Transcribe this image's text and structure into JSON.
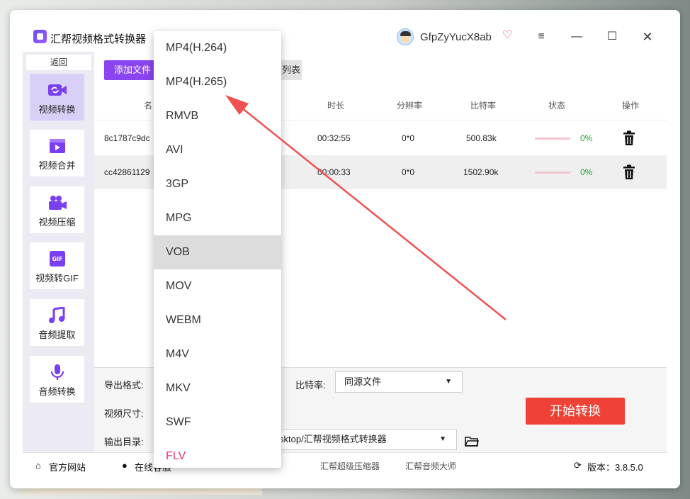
{
  "app": {
    "title": "汇帮视频格式转换器",
    "username": "GfpZyYucX8ab"
  },
  "window_controls": {
    "menu": "≡",
    "minimize": "—",
    "maximize": "☐",
    "close": "✕"
  },
  "sidebar": {
    "back": "返回",
    "items": [
      {
        "label": "视频转换",
        "icon": "video-convert-icon",
        "active": true
      },
      {
        "label": "视频合并",
        "icon": "video-merge-icon"
      },
      {
        "label": "视频压缩",
        "icon": "video-compress-icon"
      },
      {
        "label": "视频转GIF",
        "icon": "gif-icon"
      },
      {
        "label": "音频提取",
        "icon": "music-note-icon"
      },
      {
        "label": "音频转换",
        "icon": "microphone-icon"
      }
    ]
  },
  "toolbar": {
    "add_files": "添加文件",
    "list_partial": "列表"
  },
  "table": {
    "headers": {
      "name": "名",
      "duration": "时长",
      "resolution": "分辨率",
      "bitrate": "比特率",
      "status": "状态",
      "actions": "操作"
    },
    "rows": [
      {
        "name": "8c1787c9dc",
        "duration": "00:32:55",
        "resolution": "0*0",
        "bitrate": "500.83k",
        "progress": "0%"
      },
      {
        "name": "cc42861129",
        "duration": "00:00:33",
        "resolution": "0*0",
        "bitrate": "1502.90k",
        "progress": "0%"
      }
    ]
  },
  "settings": {
    "export_format_label": "导出格式:",
    "video_size_label": "视频尺寸:",
    "output_dir_label": "输出目录:",
    "bitrate_label": "比特率:",
    "bitrate_value": "同源文件",
    "output_dir_value": "sktop/汇帮视频格式转换器",
    "start_button": "开始转换"
  },
  "footer": {
    "website": "官方网站",
    "online_service": "在线客服",
    "link1": "汇帮超级压缩器",
    "link2": "汇帮音频大师",
    "version": "版本：3.8.5.0"
  },
  "dropdown": {
    "options": [
      "MP4(H.264)",
      "MP4(H.265)",
      "RMVB",
      "AVI",
      "3GP",
      "MPG",
      "VOB",
      "MOV",
      "WEBM",
      "M4V",
      "MKV",
      "SWF",
      "FLV"
    ],
    "highlighted": "VOB"
  },
  "colors": {
    "accent": "#8a45f0",
    "start": "#ef4136",
    "progress_text": "#22a32b",
    "flv": "#e8306e",
    "arrow": "#f05050"
  }
}
